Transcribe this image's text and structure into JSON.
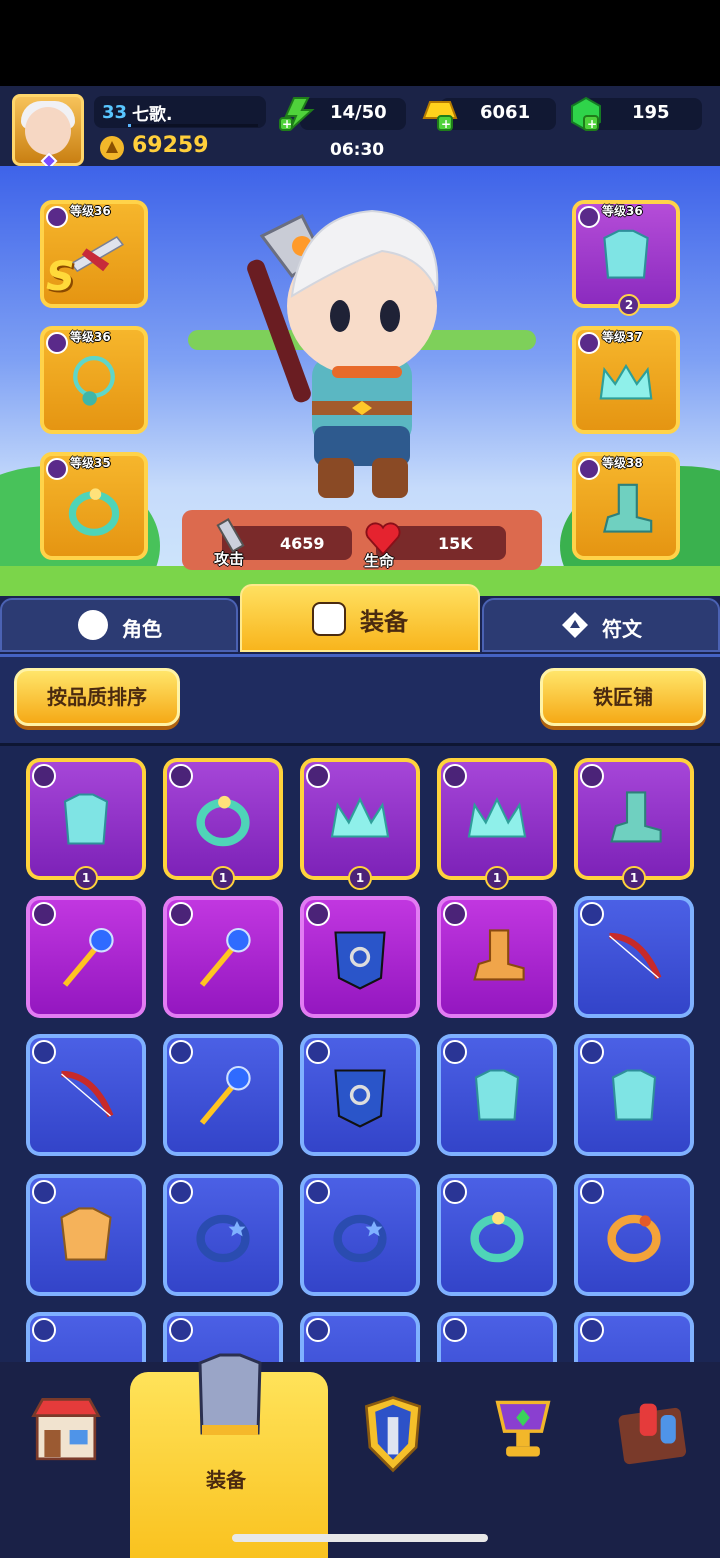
{
  "header": {
    "player_level": "33",
    "player_name": "七歌.",
    "player_xp_fraction": 0.02,
    "combat_power": "69259",
    "energy": "14/50",
    "gold": "6061",
    "gems": "195",
    "timer": "06:30"
  },
  "hero": {
    "left_slots": [
      {
        "level": "等级36",
        "rank": "S",
        "item": "crossbow-icon"
      },
      {
        "level": "等级36",
        "item": "necklace-icon"
      },
      {
        "level": "等级35",
        "item": "ring-icon"
      }
    ],
    "right_slots": [
      {
        "level": "等级36",
        "item": "armor-icon",
        "star": "2"
      },
      {
        "level": "等级37",
        "item": "crown-icon"
      },
      {
        "level": "等级38",
        "item": "boots-icon"
      }
    ],
    "attack_label": "攻击",
    "attack_value": "4659",
    "health_label": "生命",
    "health_value": "15K"
  },
  "tabs": [
    {
      "label": "角色"
    },
    {
      "label": "装备"
    },
    {
      "label": "符文"
    }
  ],
  "actions": {
    "sort_label": "按品质排序",
    "blacksmith_label": "铁匠铺"
  },
  "inventory": {
    "row1": [
      "1",
      "1",
      "1",
      "1",
      "1"
    ]
  },
  "bottom_nav": {
    "active_label": "装备"
  },
  "colors": {
    "accent_gold": "#ffd34a",
    "epic_purple": "#8b2bbf",
    "rare_blue": "#3344c9"
  }
}
